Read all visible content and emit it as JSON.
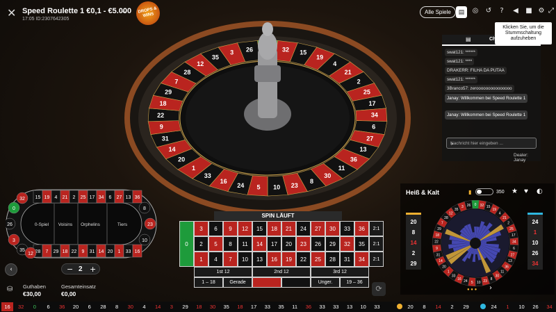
{
  "header": {
    "game_title": "Speed Roulette 1 €0,1 - €5.000",
    "time": "17:05",
    "game_id": "ID:2307642305",
    "promo_badge": "DROPS & WINS",
    "all_games_label": "Alle Spiele",
    "icons": [
      "chat-icon",
      "history-icon",
      "replay-icon",
      "help-icon",
      "volume-icon",
      "video-icon",
      "settings-icon",
      "fullscreen-icon"
    ]
  },
  "tooltip": {
    "text": "Klicken Sie, um die Stummschaltung aufzuheben"
  },
  "chat": {
    "tab_label": "Ch",
    "messages": [
      {
        "user": "swat121:",
        "text": "******",
        "dealer": false
      },
      {
        "user": "swat121:",
        "text": "****",
        "dealer": false
      },
      {
        "user": "DRAKERR:",
        "text": "FILHA DA PUTAA",
        "dealer": false
      },
      {
        "user": "swat121:",
        "text": "******",
        "dealer": false
      },
      {
        "user": "3Branco57:",
        "text": "zerooooooooooooooo",
        "dealer": false
      },
      {
        "user": "Janay:",
        "text": "Willkommen bei Speed Roulette 1",
        "dealer": true
      },
      {
        "user": "Janay:",
        "text": "Willkommen bei Speed Roulette 1",
        "dealer": true
      }
    ],
    "input_placeholder": "Nachricht hier eingeben ...",
    "dealer_label": "Dealer: Janay"
  },
  "wheel": {
    "order": [
      0,
      32,
      15,
      19,
      4,
      21,
      2,
      25,
      17,
      34,
      6,
      27,
      13,
      36,
      11,
      30,
      8,
      23,
      10,
      5,
      24,
      16,
      33,
      1,
      20,
      14,
      31,
      9,
      22,
      18,
      29,
      7,
      28,
      12,
      35,
      3,
      26
    ],
    "red_numbers": [
      1,
      3,
      5,
      7,
      9,
      12,
      14,
      16,
      18,
      19,
      21,
      23,
      25,
      27,
      30,
      32,
      34,
      36
    ]
  },
  "racetrack": {
    "left_numbers": [
      "5",
      "10",
      "23",
      "8",
      "30",
      "11",
      "36",
      "13",
      "27",
      "6",
      "34",
      "17",
      "25",
      "2",
      "21",
      "4",
      "19",
      "15",
      "32",
      "0",
      "26"
    ],
    "sections": [
      "0-Spiel",
      "Voisins",
      "Orphelins",
      "Tiers"
    ],
    "top_row": [
      "15",
      "19",
      "4",
      "21",
      "2",
      "25",
      "17",
      "34",
      "6",
      "27",
      "13",
      "36",
      "11",
      "30"
    ],
    "bottom_row": [
      "28",
      "7",
      "29",
      "18",
      "22",
      "9",
      "31",
      "14",
      "20",
      "1",
      "33",
      "16",
      "24",
      "5"
    ],
    "left_end": [
      "32",
      "0",
      "26",
      "3",
      "35",
      "12"
    ],
    "right_end": [
      "8",
      "23",
      "10"
    ]
  },
  "table": {
    "status": "SPIN LÄUFT",
    "zero": "0",
    "rows": [
      [
        "3",
        "6",
        "9",
        "12",
        "15",
        "18",
        "21",
        "24",
        "27",
        "30",
        "33",
        "36"
      ],
      [
        "2",
        "5",
        "8",
        "11",
        "14",
        "17",
        "20",
        "23",
        "26",
        "29",
        "32",
        "35"
      ],
      [
        "1",
        "4",
        "7",
        "10",
        "13",
        "16",
        "19",
        "22",
        "25",
        "28",
        "31",
        "34"
      ]
    ],
    "column_bet": "2:1",
    "dozens": [
      "1st 12",
      "2nd 12",
      "3rd 12"
    ],
    "evens": [
      "1 - 18",
      "Gerade",
      "",
      "",
      "Ungerade",
      "19 - 36"
    ],
    "evens_display": [
      "1 – 18",
      "Gerade",
      "",
      "",
      "Unger.",
      "19 – 36"
    ],
    "red_numbers": [
      1,
      3,
      5,
      7,
      9,
      12,
      14,
      16,
      18,
      19,
      21,
      23,
      25,
      27,
      30,
      32,
      34,
      36
    ]
  },
  "hot_cold": {
    "title": "Heiß & Kalt",
    "count": "350",
    "hot": [
      "20",
      "8",
      "14",
      "2",
      "29"
    ],
    "cold": [
      "24",
      "1",
      "10",
      "26",
      "34"
    ]
  },
  "controls": {
    "chip_value": "2",
    "minus": "−",
    "plus": "+",
    "back": "‹",
    "next": "›",
    "balance_label": "Guthaben",
    "balance_value": "€30,00",
    "total_bet_label": "Gesamteinsatz",
    "total_bet_value": "€0,00"
  },
  "history": {
    "left": [
      {
        "n": "16",
        "s": "redbg"
      },
      {
        "n": "32",
        "s": "red"
      },
      {
        "n": "0",
        "s": "green"
      },
      {
        "n": "6",
        "s": ""
      },
      {
        "n": "36",
        "s": "red"
      },
      {
        "n": "20",
        "s": ""
      },
      {
        "n": "6",
        "s": ""
      },
      {
        "n": "28",
        "s": ""
      },
      {
        "n": "8",
        "s": ""
      },
      {
        "n": "30",
        "s": "red"
      },
      {
        "n": "4",
        "s": ""
      },
      {
        "n": "14",
        "s": "red"
      },
      {
        "n": "3",
        "s": "red"
      },
      {
        "n": "29",
        "s": ""
      },
      {
        "n": "18",
        "s": "red"
      },
      {
        "n": "30",
        "s": "red"
      },
      {
        "n": "35",
        "s": ""
      },
      {
        "n": "18",
        "s": "red"
      },
      {
        "n": "17",
        "s": ""
      },
      {
        "n": "33",
        "s": ""
      },
      {
        "n": "35",
        "s": ""
      },
      {
        "n": "11",
        "s": ""
      },
      {
        "n": "36",
        "s": "red"
      },
      {
        "n": "33",
        "s": ""
      },
      {
        "n": "33",
        "s": ""
      },
      {
        "n": "13",
        "s": ""
      },
      {
        "n": "10",
        "s": ""
      },
      {
        "n": "33",
        "s": ""
      }
    ],
    "right": [
      {
        "n": "20",
        "s": ""
      },
      {
        "n": "8",
        "s": ""
      },
      {
        "n": "14",
        "s": "red"
      },
      {
        "n": "2",
        "s": ""
      },
      {
        "n": "29",
        "s": ""
      },
      {
        "n": "24",
        "s": ""
      },
      {
        "n": "1",
        "s": "red"
      },
      {
        "n": "10",
        "s": ""
      },
      {
        "n": "26",
        "s": ""
      },
      {
        "n": "34",
        "s": "red"
      }
    ]
  }
}
